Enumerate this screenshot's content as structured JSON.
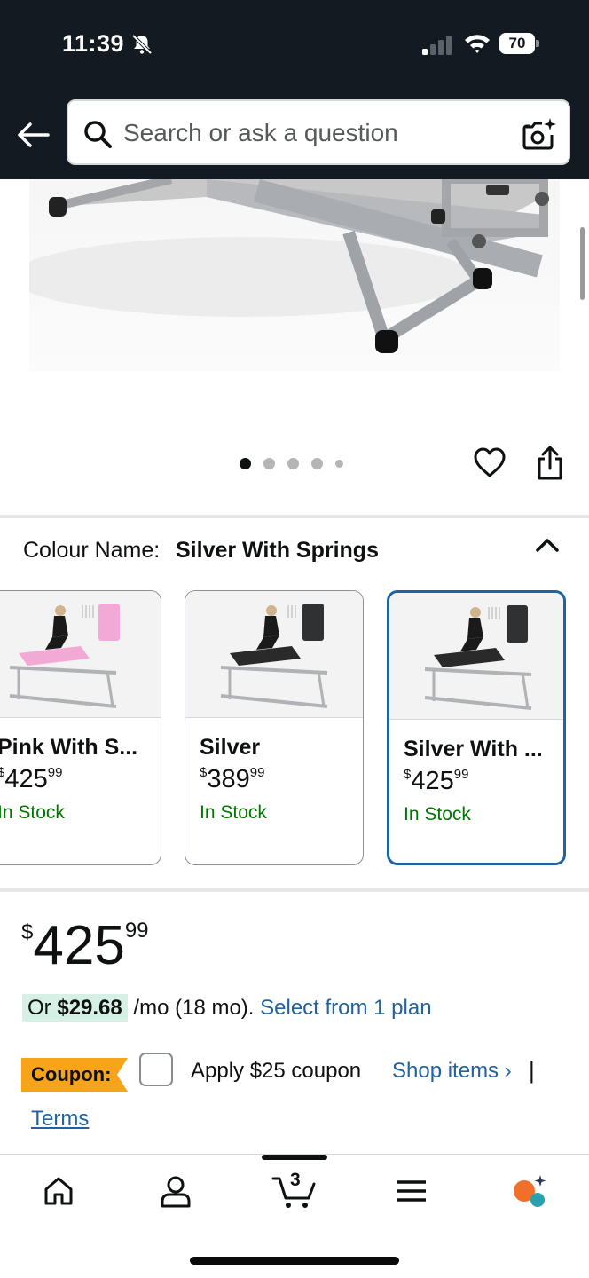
{
  "status_bar": {
    "time": "11:39",
    "battery": "70",
    "icons": [
      "bell-slash-icon",
      "cellular-signal-icon",
      "wifi-icon",
      "battery-icon"
    ]
  },
  "search": {
    "placeholder": "Search or ask a question",
    "value": ""
  },
  "gallery": {
    "image_count": 5,
    "active_index": 0
  },
  "colour": {
    "label": "Colour Name:",
    "selected_value": "Silver With Springs",
    "options": [
      {
        "name": "Pink With S...",
        "currency": "$",
        "whole": "425",
        "fraction": "99",
        "stock": "In Stock",
        "selected": false
      },
      {
        "name": "Silver",
        "currency": "$",
        "whole": "389",
        "fraction": "99",
        "stock": "In Stock",
        "selected": false
      },
      {
        "name": "Silver With ...",
        "currency": "$",
        "whole": "425",
        "fraction": "99",
        "stock": "In Stock",
        "selected": true
      }
    ]
  },
  "price": {
    "currency": "$",
    "whole": "425",
    "fraction": "99"
  },
  "financing": {
    "prefix": "Or",
    "amount": "$29.68",
    "terms": "/mo (18 mo).",
    "link": "Select from 1 plan"
  },
  "coupon": {
    "badge": "Coupon:",
    "apply_text": "Apply $25 coupon",
    "shop_link": "Shop items ›",
    "separator": "|",
    "terms_link": "Terms",
    "checked": false
  },
  "bottom_nav": {
    "cart_count": "3",
    "items": [
      "home-icon",
      "account-icon",
      "cart-icon",
      "menu-icon",
      "rufus-ai-icon"
    ]
  },
  "colors": {
    "header_bg": "#131a22",
    "link": "#2162a1",
    "in_stock": "#007600",
    "selected_border": "#2162a1",
    "coupon_badge": "#f8a41b",
    "financing_highlight": "#d6f0e5",
    "ai_orange": "#f0702a",
    "ai_teal": "#2a9fb0"
  }
}
